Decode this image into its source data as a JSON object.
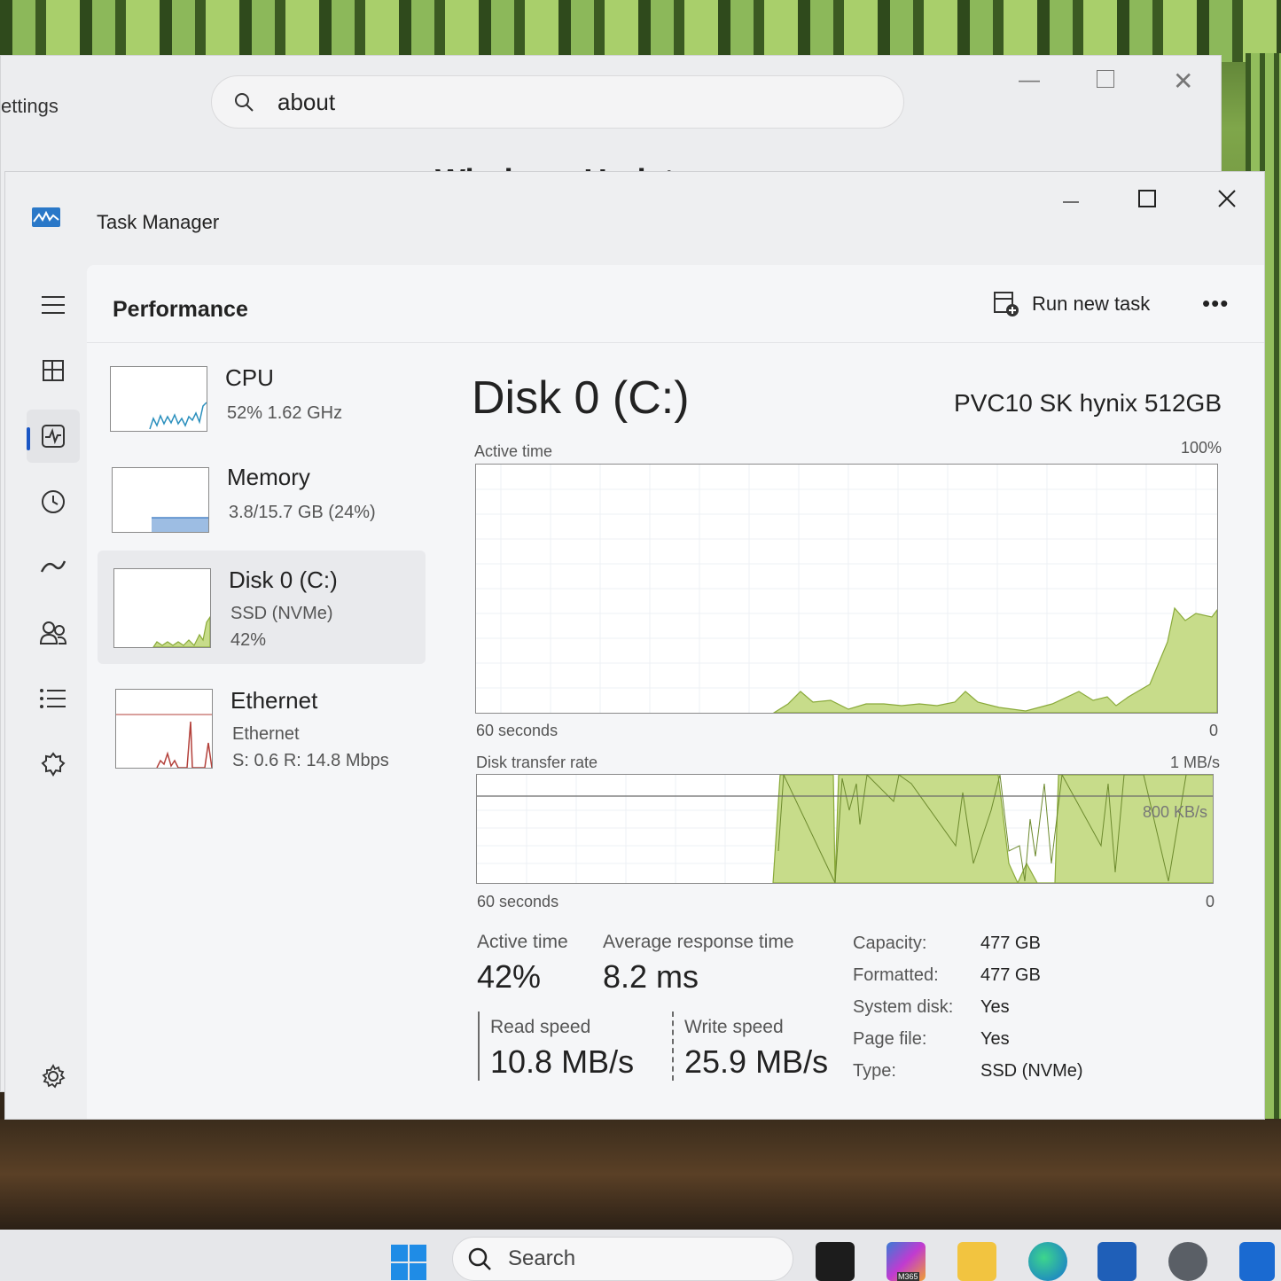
{
  "settings": {
    "title": "ettings",
    "search_value": "about",
    "heading": "Windows Update"
  },
  "window": {
    "title": "Task Manager"
  },
  "header": {
    "page_title": "Performance",
    "run_new_task": "Run new task",
    "more": "•••"
  },
  "nav": {
    "items": [
      "menu-icon",
      "processes-icon",
      "performance-icon",
      "app-history-icon",
      "startup-apps-icon",
      "users-icon",
      "details-icon",
      "services-icon",
      "settings-icon"
    ]
  },
  "perf_items": [
    {
      "name": "CPU",
      "sub1": "52%  1.62 GHz"
    },
    {
      "name": "Memory",
      "sub1": "3.8/15.7 GB (24%)"
    },
    {
      "name": "Disk 0 (C:)",
      "sub1": "SSD (NVMe)",
      "sub2": "42%"
    },
    {
      "name": "Ethernet",
      "sub1": "Ethernet",
      "sub2": "S: 0.6  R: 14.8 Mbps"
    }
  ],
  "disk": {
    "title": "Disk 0 (C:)",
    "model": "PVC10 SK hynix 512GB",
    "active_graph": {
      "label": "Active time",
      "max_label": "100%",
      "time_label": "60 seconds",
      "min_label": "0"
    },
    "transfer_graph": {
      "label": "Disk transfer rate",
      "max_label": "1 MB/s",
      "ref_label": "800 KB/s",
      "time_label": "60 seconds",
      "min_label": "0"
    },
    "stats": {
      "active_time_label": "Active time",
      "active_time_value": "42%",
      "avg_response_label": "Average response time",
      "avg_response_value": "8.2 ms",
      "read_label": "Read speed",
      "read_value": "10.8 MB/s",
      "write_label": "Write speed",
      "write_value": "25.9 MB/s"
    },
    "properties": [
      {
        "label": "Capacity:",
        "value": "477 GB"
      },
      {
        "label": "Formatted:",
        "value": "477 GB"
      },
      {
        "label": "System disk:",
        "value": "Yes"
      },
      {
        "label": "Page file:",
        "value": "Yes"
      },
      {
        "label": "Type:",
        "value": "SSD (NVMe)"
      }
    ]
  },
  "taskbar": {
    "search_label": "Search",
    "m365_label": "M365"
  },
  "colors": {
    "disk_fill": "#c7dc8a",
    "disk_line": "#8aaa3a",
    "cpu_line": "#2a8fbd",
    "memory_fill": "#9dbde3",
    "ethernet_line": "#b3403a",
    "accent": "#1a56c4"
  }
}
